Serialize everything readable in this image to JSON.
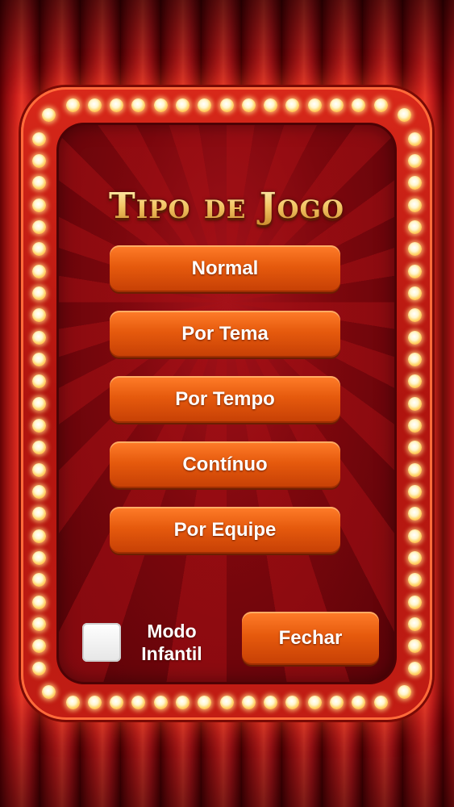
{
  "title": "Tipo de Jogo",
  "menu": {
    "items": [
      {
        "label": "Normal"
      },
      {
        "label": "Por Tema"
      },
      {
        "label": "Por Tempo"
      },
      {
        "label": "Contínuo"
      },
      {
        "label": "Por Equipe"
      }
    ]
  },
  "kids_mode": {
    "label_line1": "Modo",
    "label_line2": "Infantil",
    "checked": false
  },
  "close_label": "Fechar",
  "colors": {
    "curtain": "#c81b1b",
    "marquee": "#c21d14",
    "panel": "#7c070d",
    "button": "#e65a0d",
    "title_gold": "#f4d07a",
    "bulb": "#fff6cf"
  }
}
